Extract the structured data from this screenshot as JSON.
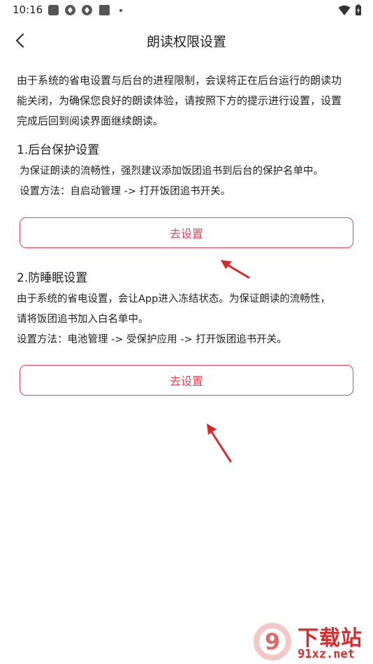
{
  "status_bar": {
    "time": "10:16",
    "left_icons": [
      "gallery-icon",
      "sync-icon",
      "sync-icon",
      "app-icon",
      "dot-icon"
    ],
    "right_icons": [
      "wifi-icon",
      "battery-charging-icon"
    ]
  },
  "header": {
    "title": "朗读权限设置",
    "back_icon": "chevron-left-icon"
  },
  "intro": {
    "line1": "由于系统的省电设置与后台的进程限制，会误将正在后台运行的朗读功",
    "line2": "能关闭，为确保您良好的朗读体验，请按照下方的提示进行设置，设置",
    "line3": "完成后回到阅读界面继续朗读。"
  },
  "section1": {
    "title": "1.后台保护设置",
    "desc": "为保证朗读的流畅性，强烈建议添加饭团追书到后台的保护名单中。",
    "method": "设置方法：自启动管理 -> 打开饭团追书开关。",
    "button_label": "去设置"
  },
  "section2": {
    "title": "2.防睡眠设置",
    "desc_line1": "由于系统的省电设置，会让App进入冻结状态。为保证朗读的流畅性，",
    "desc_line2": "请将饭团追书加入白名单中。",
    "method": "设置方法：电池管理 -> 受保护应用 -> 打开饭团追书开关。",
    "button_label": "去设置"
  },
  "watermark": {
    "badge_text": "9",
    "brand": "下载站",
    "url": "91xz.net"
  },
  "colors": {
    "accent": "#e0455a",
    "arrow": "#d42a2a",
    "watermark": "#d42e2e"
  }
}
